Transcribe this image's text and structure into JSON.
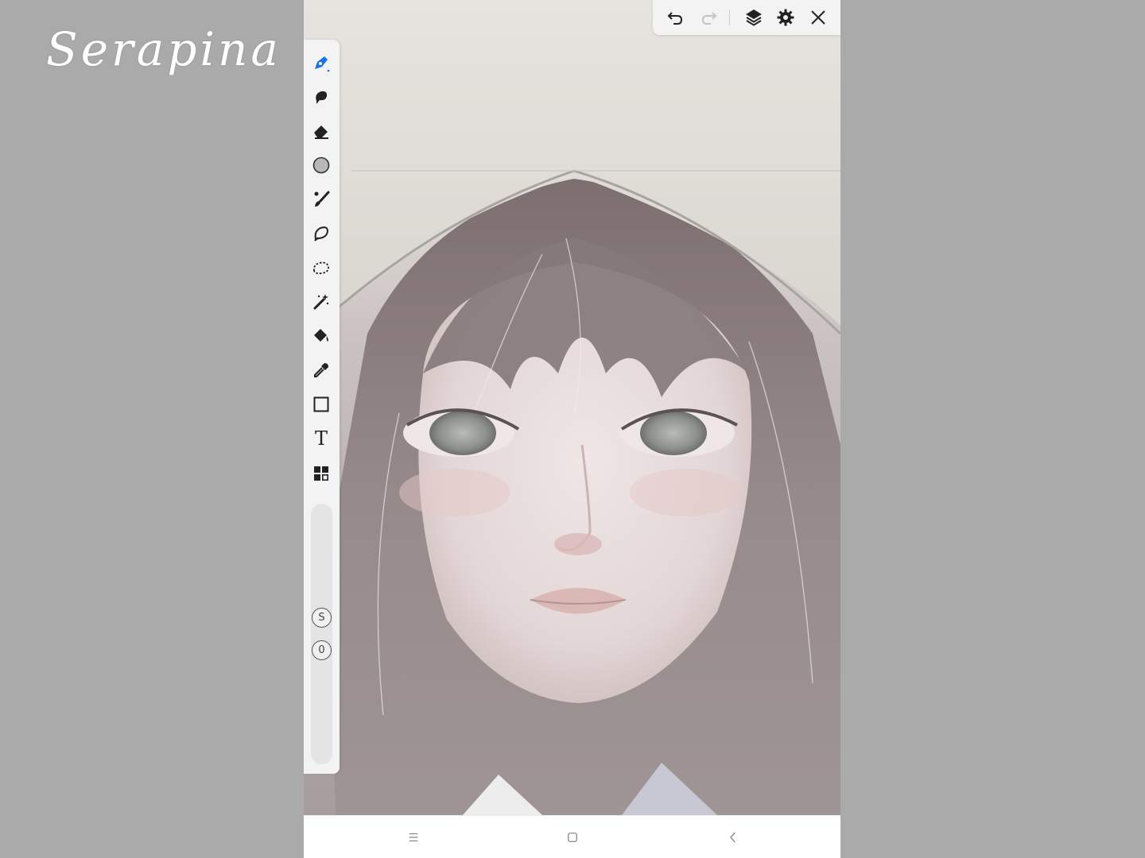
{
  "watermark": {
    "text": "Serapina"
  },
  "colors": {
    "active_tool": "#1a73e8",
    "icon": "#222222",
    "icon_disabled": "#c4c4c4",
    "panel_bg": "#f3f3f3",
    "page_bg": "#aaaaaa"
  },
  "toolbar": {
    "tools": [
      {
        "name": "pen-tool",
        "icon": "pen-icon",
        "active": true
      },
      {
        "name": "smudge-tool",
        "icon": "smudge-icon"
      },
      {
        "name": "eraser-tool",
        "icon": "eraser-icon"
      },
      {
        "name": "blur-tool",
        "icon": "circle-icon"
      },
      {
        "name": "brush-tool",
        "icon": "brush-icon"
      },
      {
        "name": "lasso-tool",
        "icon": "lasso-icon"
      },
      {
        "name": "selection-tool",
        "icon": "dotted-selection-icon"
      },
      {
        "name": "magic-wand-tool",
        "icon": "magic-wand-icon"
      },
      {
        "name": "fill-tool",
        "icon": "paint-bucket-icon"
      },
      {
        "name": "eyedropper-tool",
        "icon": "eyedropper-icon"
      },
      {
        "name": "shape-tool",
        "icon": "square-icon"
      },
      {
        "name": "text-tool",
        "icon": "text-icon"
      },
      {
        "name": "more-tools",
        "icon": "grid-icon"
      }
    ],
    "text_tool_glyph": "T",
    "size_button_label": "S",
    "opacity_button_label": "0"
  },
  "topbar": {
    "buttons": [
      "undo-icon",
      "redo-icon",
      "layers-icon",
      "gear-icon",
      "close-icon"
    ],
    "redo_disabled": true
  },
  "navbar": {
    "buttons": [
      "menu-icon",
      "home-icon",
      "back-icon"
    ]
  }
}
